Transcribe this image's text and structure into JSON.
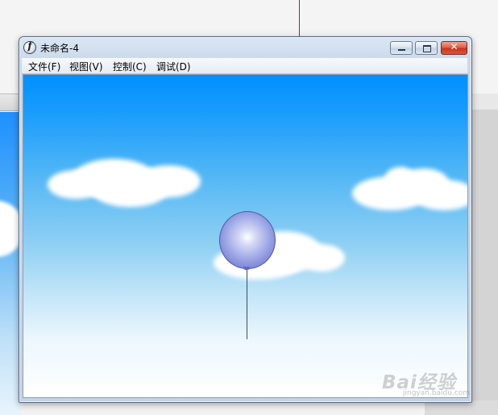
{
  "window": {
    "title": "未命名-4",
    "app_icon_glyph": "f",
    "controls": {
      "minimize_icon": "minimize-icon",
      "maximize_icon": "maximize-icon",
      "close_icon": "close-icon",
      "close_glyph": "✕"
    }
  },
  "menu": {
    "items": [
      {
        "label": "文件(F)"
      },
      {
        "label": "视图(V)"
      },
      {
        "label": "控制(C)"
      },
      {
        "label": "调试(D)"
      }
    ]
  },
  "stage": {
    "sky_top_color": "#0090ff",
    "sky_bottom_color": "#ffffff",
    "balloon_color": "#8f97df"
  },
  "watermark": {
    "text": "Bai经验",
    "sub": "jingyan.baidu.com"
  }
}
